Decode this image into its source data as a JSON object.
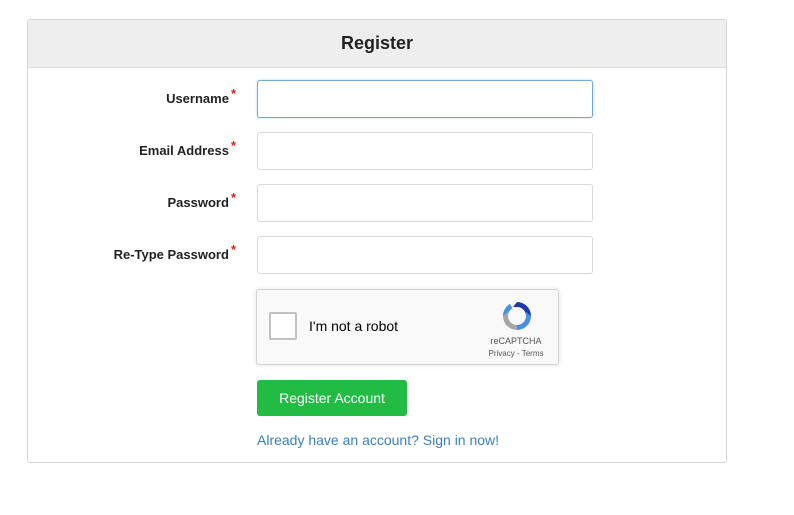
{
  "panel": {
    "title": "Register"
  },
  "form": {
    "required_marker": "*",
    "fields": [
      {
        "label": "Username",
        "value": "",
        "placeholder": ""
      },
      {
        "label": "Email Address",
        "value": "",
        "placeholder": ""
      },
      {
        "label": "Password",
        "value": "",
        "placeholder": ""
      },
      {
        "label": "Re-Type Password",
        "value": "",
        "placeholder": ""
      }
    ]
  },
  "recaptcha": {
    "label": "I'm not a robot",
    "brand": "reCAPTCHA",
    "privacy": "Privacy",
    "separator": " - ",
    "terms": "Terms",
    "logo_icon": "recaptcha-logo-icon"
  },
  "actions": {
    "submit_label": "Register Account",
    "signin_link": "Already have an account? Sign in now!"
  },
  "colors": {
    "submit_button": "#22bb44",
    "link": "#3a7fc1",
    "required": "#d9211e",
    "header_bg": "#eeeeee"
  }
}
